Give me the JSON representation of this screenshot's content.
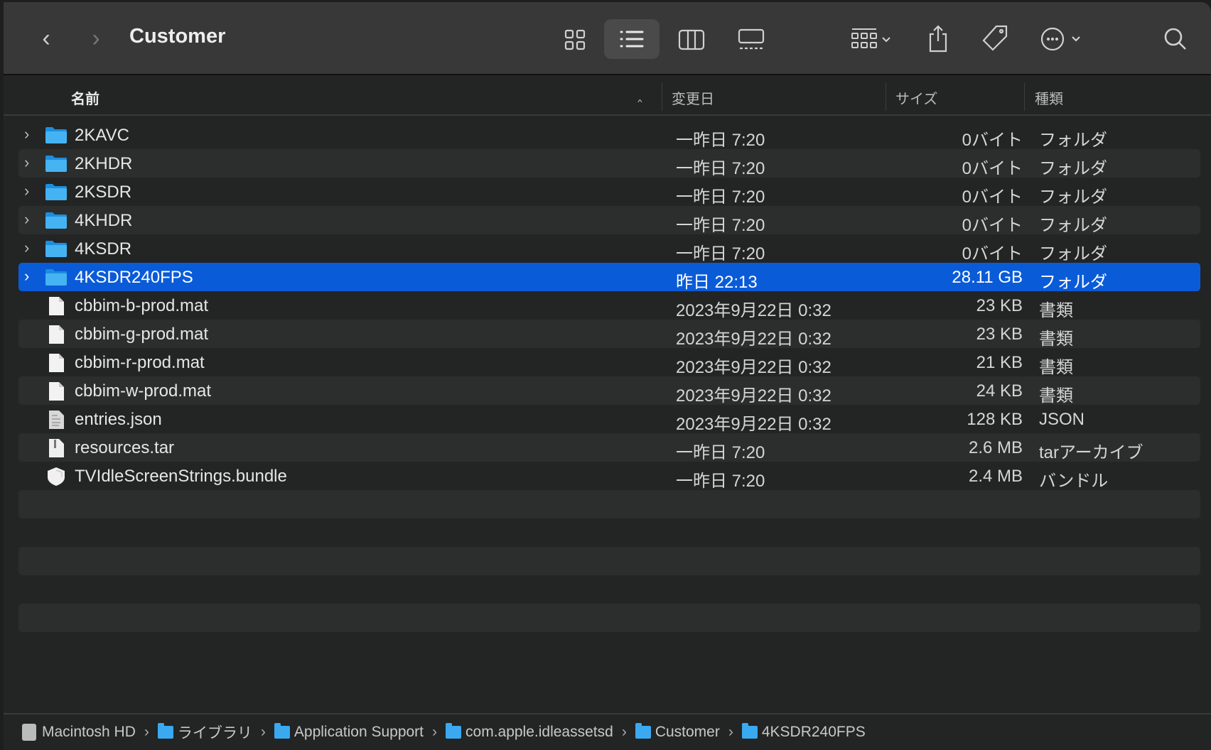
{
  "toolbar": {
    "title": "Customer"
  },
  "columns": {
    "name": "名前",
    "date": "変更日",
    "size": "サイズ",
    "kind": "種類"
  },
  "rows": [
    {
      "name": "2KAVC",
      "date": "一昨日 7:20",
      "size": "0バイト",
      "kind": "フォルダ",
      "type": "folder"
    },
    {
      "name": "2KHDR",
      "date": "一昨日 7:20",
      "size": "0バイト",
      "kind": "フォルダ",
      "type": "folder"
    },
    {
      "name": "2KSDR",
      "date": "一昨日 7:20",
      "size": "0バイト",
      "kind": "フォルダ",
      "type": "folder"
    },
    {
      "name": "4KHDR",
      "date": "一昨日 7:20",
      "size": "0バイト",
      "kind": "フォルダ",
      "type": "folder"
    },
    {
      "name": "4KSDR",
      "date": "一昨日 7:20",
      "size": "0バイト",
      "kind": "フォルダ",
      "type": "folder"
    },
    {
      "name": "4KSDR240FPS",
      "date": "昨日 22:13",
      "size": "28.11 GB",
      "kind": "フォルダ",
      "type": "folder",
      "selected": true
    },
    {
      "name": "cbbim-b-prod.mat",
      "date": "2023年9月22日 0:32",
      "size": "23 KB",
      "kind": "書類",
      "type": "doc"
    },
    {
      "name": "cbbim-g-prod.mat",
      "date": "2023年9月22日 0:32",
      "size": "23 KB",
      "kind": "書類",
      "type": "doc"
    },
    {
      "name": "cbbim-r-prod.mat",
      "date": "2023年9月22日 0:32",
      "size": "21 KB",
      "kind": "書類",
      "type": "doc"
    },
    {
      "name": "cbbim-w-prod.mat",
      "date": "2023年9月22日 0:32",
      "size": "24 KB",
      "kind": "書類",
      "type": "doc"
    },
    {
      "name": "entries.json",
      "date": "2023年9月22日 0:32",
      "size": "128 KB",
      "kind": "JSON",
      "type": "json"
    },
    {
      "name": "resources.tar",
      "date": "一昨日 7:20",
      "size": "2.6 MB",
      "kind": "tarアーカイブ",
      "type": "archive"
    },
    {
      "name": "TVIdleScreenStrings.bundle",
      "date": "一昨日 7:20",
      "size": "2.4 MB",
      "kind": "バンドル",
      "type": "bundle"
    }
  ],
  "path": [
    "Macintosh HD",
    "ライブラリ",
    "Application Support",
    "com.apple.idleassetsd",
    "Customer",
    "4KSDR240FPS"
  ],
  "colors": {
    "selection": "#0a5bd8",
    "folder": "#3aa9ef"
  }
}
